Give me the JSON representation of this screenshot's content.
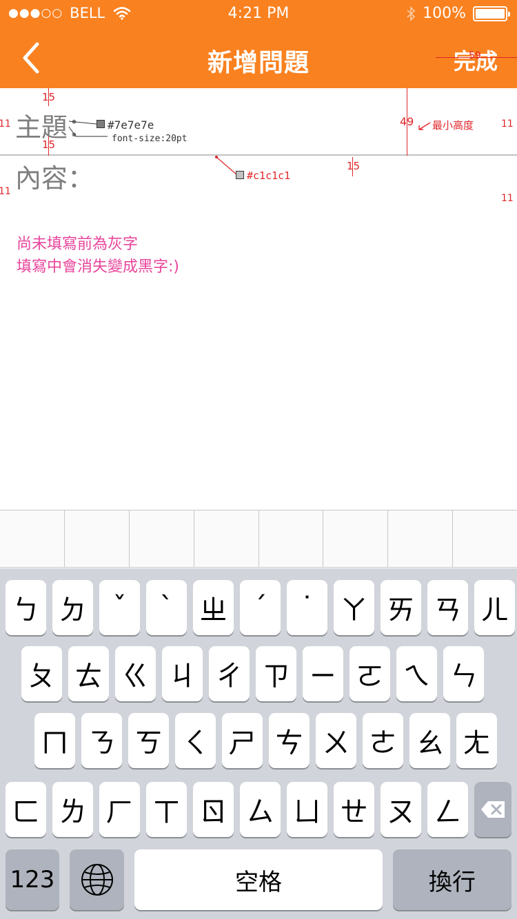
{
  "status_bar": {
    "signal": "●●●○○",
    "carrier": "BELL",
    "time": "4:21 PM",
    "battery_text": "100%",
    "battery_level": 1.0
  },
  "nav": {
    "back_icon": "chevron-left-icon",
    "title": "新增問題",
    "done": "完成"
  },
  "form": {
    "subject_label": "主題：",
    "content_label": "內容："
  },
  "note": {
    "line1": "尚未填寫前為灰字",
    "line2": "填寫中會消失變成黑字:)"
  },
  "spec": {
    "pad_top": "15",
    "pad_bottom": "15",
    "left_margin": "11",
    "right_margin": "11",
    "content_pad": "15",
    "done_width": "59",
    "min_height_value": "49",
    "min_height_label": "最小高度",
    "label_color": "#7e7e7e",
    "label_font": "font-size:20pt",
    "divider_color": "#c1c1c1"
  },
  "keyboard": {
    "row1": [
      "ㄅ",
      "ㄉ",
      "ˇ",
      "ˋ",
      "ㄓ",
      "ˊ",
      "˙",
      "ㄚ",
      "ㄞ",
      "ㄢ",
      "ㄦ"
    ],
    "row2": [
      "ㄆ",
      "ㄊ",
      "ㄍ",
      "ㄐ",
      "ㄔ",
      "ㄗ",
      "ㄧ",
      "ㄛ",
      "ㄟ",
      "ㄣ"
    ],
    "row3": [
      "ㄇ",
      "ㄋ",
      "ㄎ",
      "ㄑ",
      "ㄕ",
      "ㄘ",
      "ㄨ",
      "ㄜ",
      "ㄠ",
      "ㄤ"
    ],
    "row4": [
      "ㄈ",
      "ㄌ",
      "ㄏ",
      "ㄒ",
      "ㄖ",
      "ㄙ",
      "ㄩ",
      "ㄝ",
      "ㄡ",
      "ㄥ"
    ],
    "numbers": "123",
    "space": "空格",
    "return": "換行",
    "globe_icon": "globe-icon",
    "delete_icon": "backspace-icon"
  },
  "colors": {
    "accent": "#f98120",
    "label": "#7e7e7e",
    "divider": "#c1c1c1",
    "note": "#e8459b",
    "annotation": "#e0262a"
  }
}
